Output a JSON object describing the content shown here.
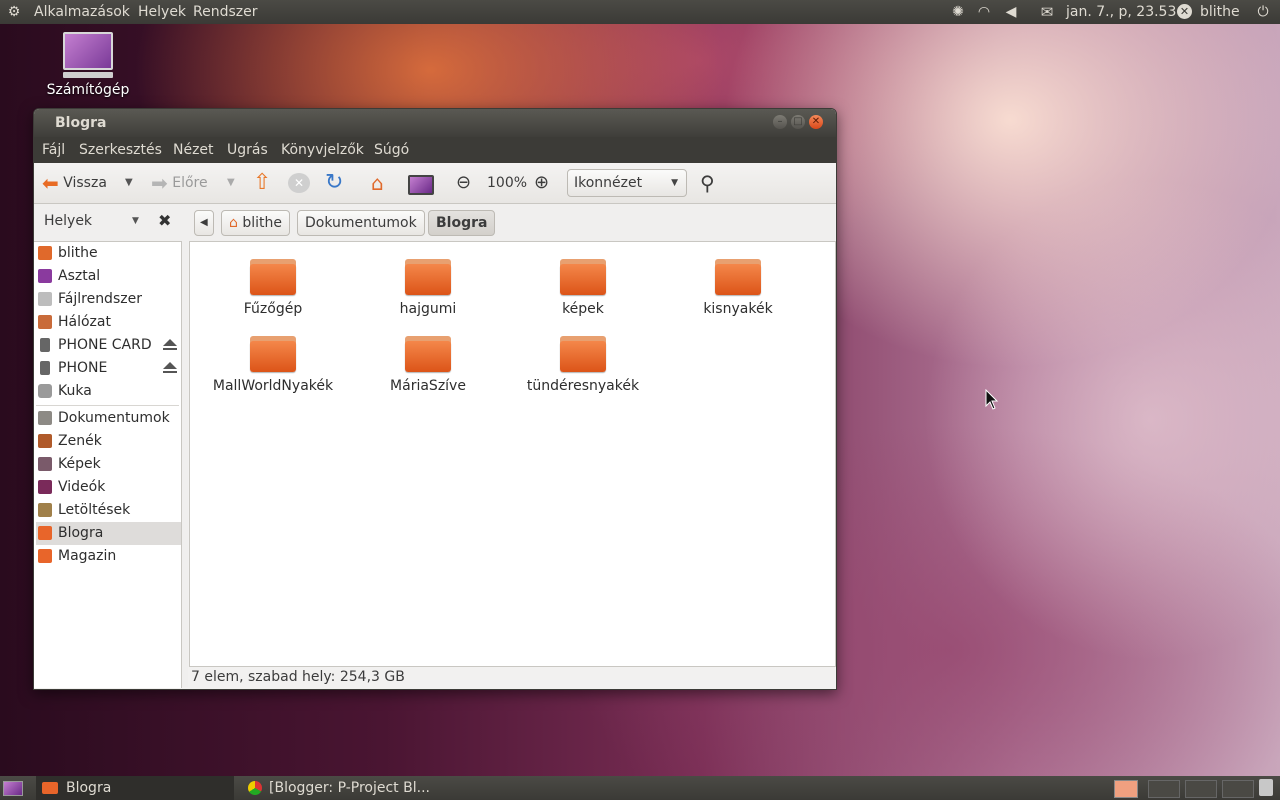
{
  "top_panel": {
    "menus": [
      "Alkalmazások",
      "Helyek",
      "Rendszer"
    ],
    "clock": "jan. 7., p, 23.53",
    "user": "blithe",
    "icons": [
      "ubuntu-logo-icon",
      "network-manager-icon",
      "wifi-icon",
      "volume-icon",
      "mail-icon",
      "user-icon",
      "power-icon"
    ]
  },
  "desktop": {
    "icon_label": "Számítógép"
  },
  "window": {
    "title": "Blogra",
    "menu": [
      "Fájl",
      "Szerkesztés",
      "Nézet",
      "Ugrás",
      "Könyvjelzők",
      "Súgó"
    ],
    "toolbar": {
      "back_label": "Vissza",
      "forward_label": "Előre",
      "zoom_level": "100%",
      "view_mode": "Ikonnézet"
    },
    "sidebar_header": "Helyek",
    "breadcrumbs": [
      "blithe",
      "Dokumentumok",
      "Blogra"
    ],
    "sidebar": {
      "items": [
        {
          "label": "blithe",
          "icon": "home-icon"
        },
        {
          "label": "Asztal",
          "icon": "desktop-icon"
        },
        {
          "label": "Fájlrendszer",
          "icon": "drive-icon"
        },
        {
          "label": "Hálózat",
          "icon": "network-icon"
        },
        {
          "label": "PHONE CARD",
          "icon": "phone-icon"
        },
        {
          "label": "PHONE",
          "icon": "phone-icon"
        },
        {
          "label": "Kuka",
          "icon": "trash-icon"
        },
        {
          "label": "Dokumentumok",
          "icon": "documents-folder-icon"
        },
        {
          "label": "Zenék",
          "icon": "music-folder-icon"
        },
        {
          "label": "Képek",
          "icon": "pictures-folder-icon"
        },
        {
          "label": "Videók",
          "icon": "videos-folder-icon"
        },
        {
          "label": "Letöltések",
          "icon": "downloads-folder-icon"
        },
        {
          "label": "Blogra",
          "icon": "folder-icon"
        },
        {
          "label": "Magazin",
          "icon": "folder-icon"
        }
      ]
    },
    "folders": [
      "Fűzőgép",
      "hajgumi",
      "képek",
      "kisnyakék",
      "MallWorldNyakék",
      "MáriaSzíve",
      "tündéresnyakék"
    ],
    "status": "7 elem, szabad hely: 254,3 GB"
  },
  "taskbar": {
    "items": [
      "Blogra",
      "[Blogger: P-Project Bl..."
    ]
  },
  "colors": {
    "panel": "#3c3b37",
    "folder_orange": "#e8652a",
    "selection": "#dedcda"
  }
}
